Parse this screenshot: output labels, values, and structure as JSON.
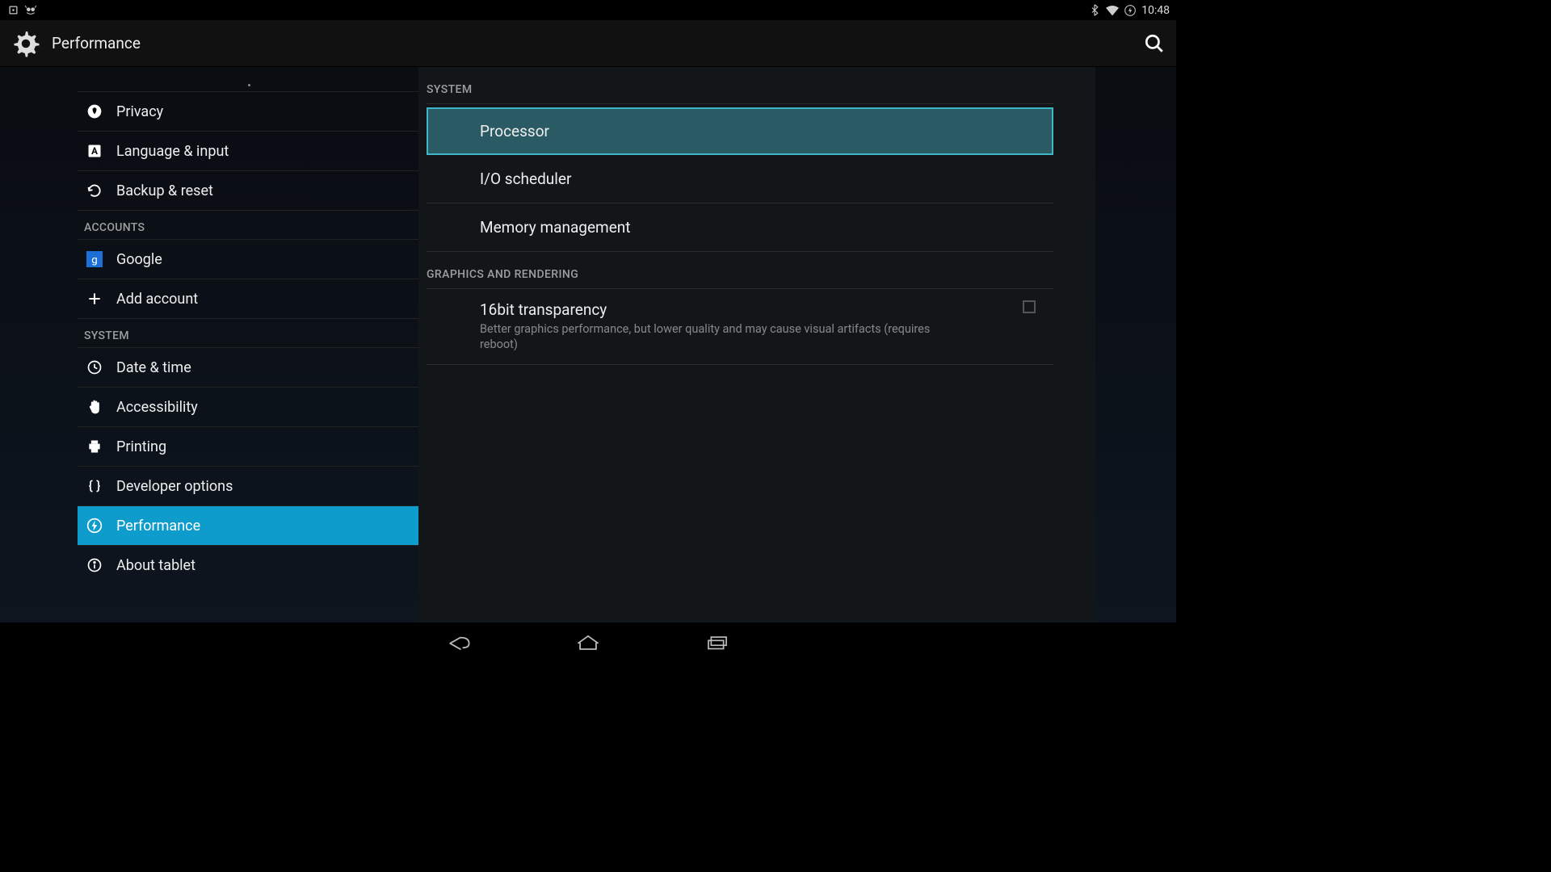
{
  "status": {
    "time": "10:48"
  },
  "action_bar": {
    "title": "Performance"
  },
  "sidebar": {
    "items_top": [
      {
        "label": "Privacy",
        "icon": "shield-icon"
      },
      {
        "label": "Language & input",
        "icon": "language-icon"
      },
      {
        "label": "Backup & reset",
        "icon": "backup-icon"
      }
    ],
    "header_accounts": "ACCOUNTS",
    "items_accounts": [
      {
        "label": "Google",
        "icon": "google-icon"
      },
      {
        "label": "Add account",
        "icon": "plus-icon"
      }
    ],
    "header_system": "SYSTEM",
    "items_system": [
      {
        "label": "Date & time",
        "icon": "clock-icon"
      },
      {
        "label": "Accessibility",
        "icon": "hand-icon"
      },
      {
        "label": "Printing",
        "icon": "printer-icon"
      },
      {
        "label": "Developer options",
        "icon": "braces-icon"
      },
      {
        "label": "Performance",
        "icon": "bolt-icon",
        "selected": true
      },
      {
        "label": "About tablet",
        "icon": "info-icon"
      }
    ]
  },
  "detail": {
    "section_system": "SYSTEM",
    "items_system": [
      {
        "title": "Processor",
        "highlight": true
      },
      {
        "title": "I/O scheduler"
      },
      {
        "title": "Memory management"
      }
    ],
    "section_graphics": "GRAPHICS AND RENDERING",
    "items_graphics": [
      {
        "title": "16bit transparency",
        "sub": "Better graphics performance, but lower quality and may cause visual artifacts (requires reboot)",
        "checkbox": false
      }
    ]
  }
}
